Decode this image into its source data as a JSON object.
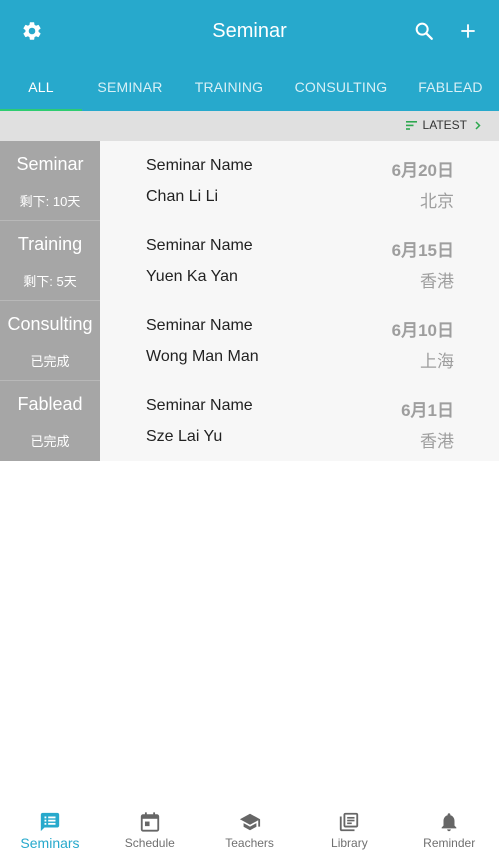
{
  "header": {
    "title": "Seminar"
  },
  "tabs": [
    {
      "label": "ALL"
    },
    {
      "label": "SEMINAR"
    },
    {
      "label": "TRAINING"
    },
    {
      "label": "CONSULTING"
    },
    {
      "label": "FABLEAD"
    }
  ],
  "sort": {
    "label": "LATEST"
  },
  "rows": [
    {
      "category": "Seminar",
      "status": "剩下: 10天",
      "name": "Seminar Name",
      "person": "Chan Li Li",
      "date": "6月20日",
      "city": "北京"
    },
    {
      "category": "Training",
      "status": "剩下: 5天",
      "name": "Seminar Name",
      "person": "Yuen Ka Yan",
      "date": "6月15日",
      "city": "香港"
    },
    {
      "category": "Consulting",
      "status": "已完成",
      "name": "Seminar Name",
      "person": "Wong Man Man",
      "date": "6月10日",
      "city": "上海"
    },
    {
      "category": "Fablead",
      "status": "已完成",
      "name": "Seminar Name",
      "person": "Sze Lai Yu",
      "date": "6月1日",
      "city": "香港"
    }
  ],
  "bottom_nav": [
    {
      "label": "Seminars",
      "icon": "chat-list-icon"
    },
    {
      "label": "Schedule",
      "icon": "calendar-icon"
    },
    {
      "label": "Teachers",
      "icon": "graduation-cap-icon"
    },
    {
      "label": "Library",
      "icon": "library-books-icon"
    },
    {
      "label": "Reminder",
      "icon": "bell-icon"
    }
  ],
  "colors": {
    "primary": "#27a9cc",
    "tab_indicator": "#2ecc71",
    "category_bg": "#a6a6a6",
    "sort_bar_bg": "#e0e0e0"
  }
}
